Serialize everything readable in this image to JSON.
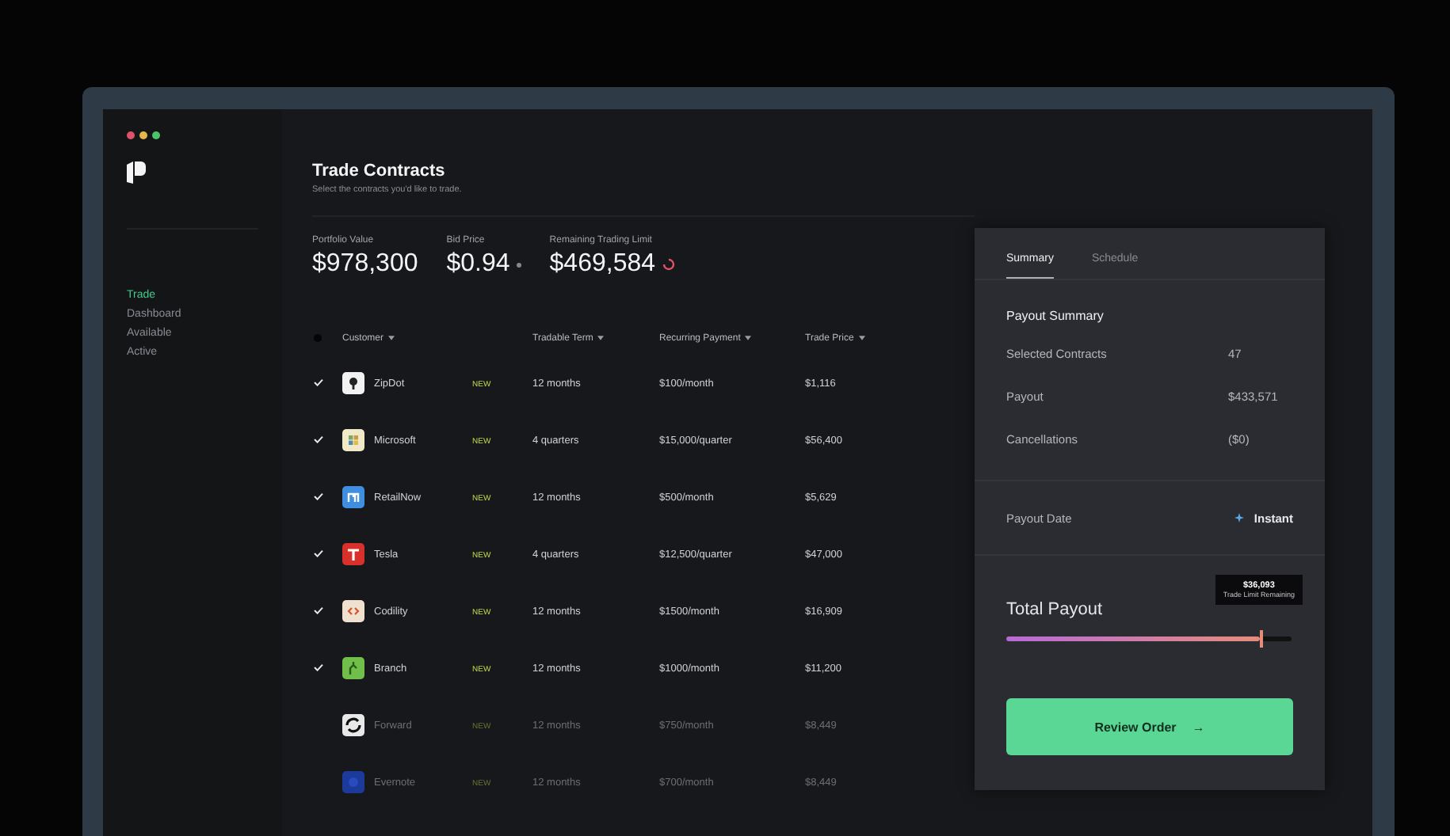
{
  "sidebar": {
    "items": [
      {
        "label": "Trade",
        "selected": true
      },
      {
        "label": "Dashboard",
        "selected": false
      },
      {
        "label": "Available",
        "selected": false
      },
      {
        "label": "Active",
        "selected": false
      }
    ]
  },
  "header": {
    "title": "Trade Contracts",
    "subtitle": "Select the contracts you'd like to trade."
  },
  "stats": [
    {
      "label": "Portfolio Value",
      "value": "$978,300",
      "kind": "plain"
    },
    {
      "label": "Bid Price",
      "value": "$0.94",
      "kind": "dot"
    },
    {
      "label": "Remaining Trading Limit",
      "value": "$469,584",
      "kind": "ring"
    }
  ],
  "table": {
    "select_all_checked": false,
    "columns": [
      "Customer",
      "Tradable Term",
      "Recurring Payment",
      "Trade Price"
    ],
    "rows": [
      {
        "checked": true,
        "customer": "ZipDot",
        "color": "#f2f2f2",
        "badge": "NEW",
        "term": "12 months",
        "payment": "$100/month",
        "price": "$1,116"
      },
      {
        "checked": true,
        "customer": "Microsoft",
        "color": "#efe9c8",
        "badge": "NEW",
        "term": "4 quarters",
        "payment": "$15,000/quarter",
        "price": "$56,400"
      },
      {
        "checked": true,
        "customer": "RetailNow",
        "color": "#3f8ee0",
        "badge": "NEW",
        "term": "12 months",
        "payment": "$500/month",
        "price": "$5,629"
      },
      {
        "checked": true,
        "customer": "Tesla",
        "color": "#d8302a",
        "badge": "NEW",
        "term": "4 quarters",
        "payment": "$12,500/quarter",
        "price": "$47,000"
      },
      {
        "checked": true,
        "customer": "Codility",
        "color": "#efe0cf",
        "badge": "NEW",
        "term": "12 months",
        "payment": "$1500/month",
        "price": "$16,909"
      },
      {
        "checked": true,
        "customer": "Branch",
        "color": "#6fbf4a",
        "badge": "NEW",
        "term": "12 months",
        "payment": "$1000/month",
        "price": "$11,200"
      },
      {
        "checked": false,
        "customer": "Forward",
        "color": "#e8e8e8",
        "badge": "NEW",
        "term": "12 months",
        "payment": "$750/month",
        "price": "$8,449"
      },
      {
        "checked": false,
        "customer": "Evernote",
        "color": "#1c3a9a",
        "badge": "NEW",
        "term": "12 months",
        "payment": "$700/month",
        "price": "$8,449"
      }
    ]
  },
  "panel": {
    "tabs": [
      {
        "label": "Summary",
        "selected": true
      },
      {
        "label": "Schedule",
        "selected": false
      }
    ],
    "section_title": "Payout Summary",
    "rows": [
      {
        "label": "Selected Contracts",
        "value": "47"
      },
      {
        "label": "Payout",
        "value": "$433,571"
      },
      {
        "label": "Cancellations",
        "value": "($0)"
      }
    ],
    "payout_date": {
      "label": "Payout Date",
      "value": "Instant"
    },
    "total": {
      "label": "Total Payout",
      "level": 0.89,
      "tooltip_value": "$36,093",
      "tooltip_label": "Trade Limit Remaining"
    },
    "button": "Review Order",
    "button_icon": "→"
  }
}
